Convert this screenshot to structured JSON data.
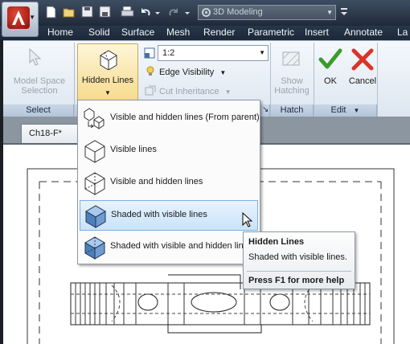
{
  "workspace": {
    "label": "3D Modeling"
  },
  "tabs": [
    "Home",
    "Solid",
    "Surface",
    "Mesh",
    "Render",
    "Parametric",
    "Insert",
    "Annotate",
    "La"
  ],
  "ribbon": {
    "select_panel": {
      "button": "Model Space Selection",
      "title": "Select"
    },
    "hidden_lines": {
      "label": "Hidden Lines"
    },
    "scale": {
      "value": "1:2"
    },
    "edge_visibility": {
      "label": "Edge Visibility"
    },
    "cut_inheritance": {
      "label": "Cut Inheritance"
    },
    "hatch_panel": {
      "button": "Show Hatching",
      "title": "Hatch"
    },
    "edit_panel": {
      "ok": "OK",
      "cancel": "Cancel",
      "title": "Edit"
    }
  },
  "file_tab": {
    "label": "Ch18-F*"
  },
  "menu": {
    "items": [
      {
        "label": "Visible and hidden lines (From parent)",
        "icon": "cube-inherit-icon"
      },
      {
        "label": "Visible lines",
        "icon": "cube-visible-icon"
      },
      {
        "label": "Visible and hidden lines",
        "icon": "cube-hidden-icon"
      },
      {
        "label": "Shaded with visible lines",
        "icon": "cube-shaded-icon"
      },
      {
        "label": "Shaded with visible and hidden lines",
        "icon": "cube-shaded-hidden-icon"
      }
    ],
    "highlighted_index": 3
  },
  "tooltip": {
    "title": "Hidden Lines",
    "description": "Shaded with visible lines.",
    "help": "Press F1 for more help"
  },
  "colors": {
    "accent_red": "#c4251c",
    "highlight_blue": "#c9e3fa",
    "ok_green": "#3a9c2a",
    "cancel_red": "#d8352a"
  }
}
